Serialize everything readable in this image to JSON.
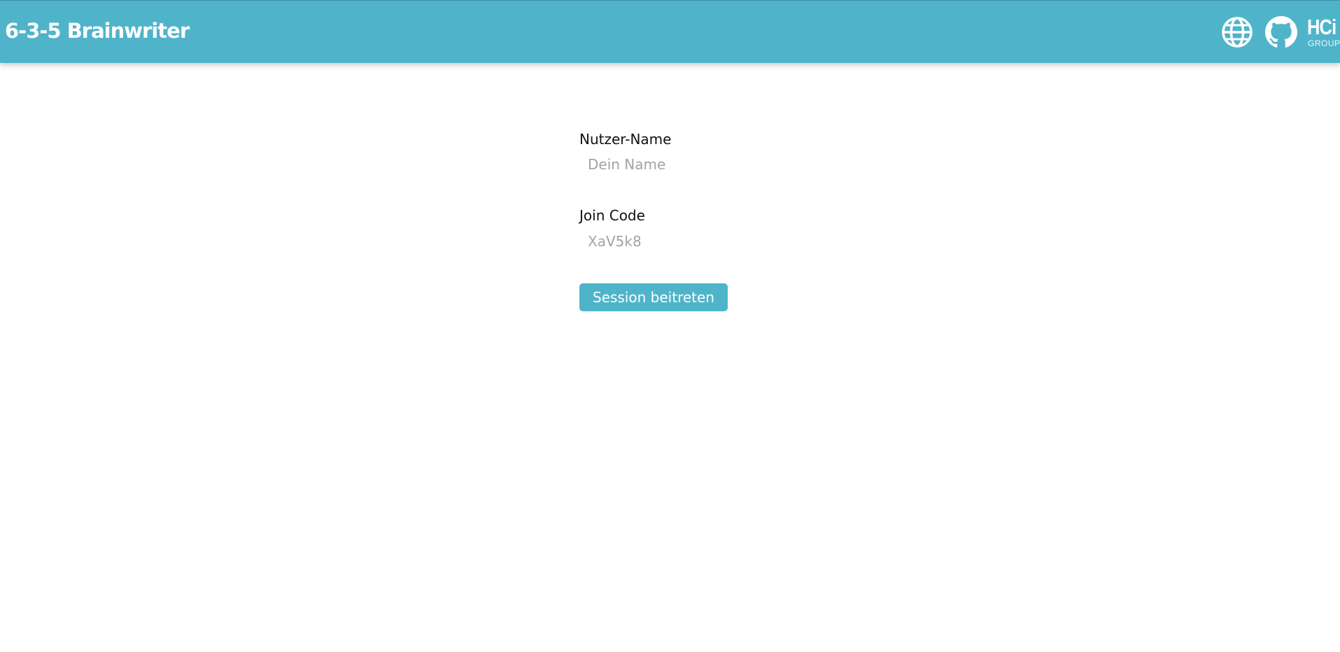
{
  "header": {
    "title": "6-3-5 Brainwriter",
    "background_color": "#4fb4ca",
    "icons": {
      "language": "globe-icon",
      "repository": "github-icon"
    },
    "logo": {
      "main_text": "HCi",
      "sub_text": "GROUP"
    }
  },
  "form": {
    "username": {
      "label": "Nutzer-Name",
      "placeholder": "Dein Name",
      "value": ""
    },
    "join_code": {
      "label": "Join Code",
      "placeholder": "XaV5k8",
      "value": ""
    },
    "submit_label": "Session beitreten",
    "accent_color": "#4fb4ca"
  }
}
